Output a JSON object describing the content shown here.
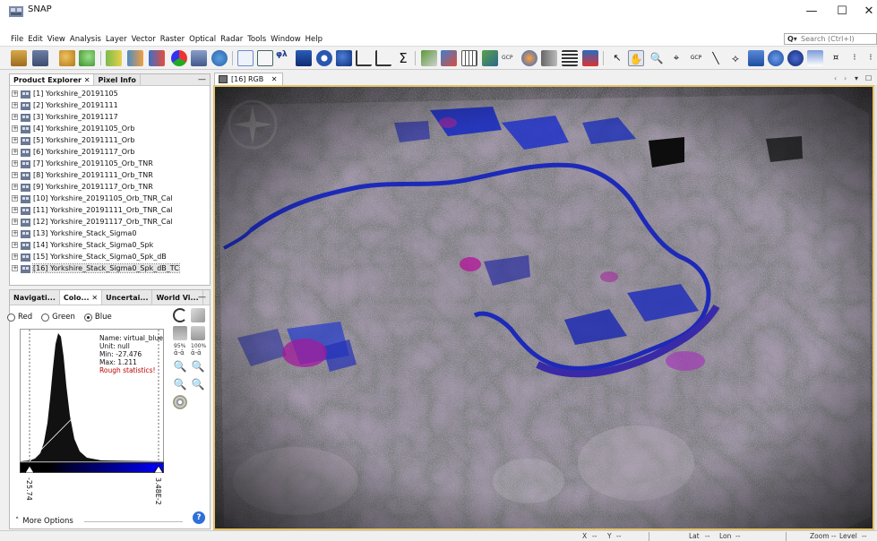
{
  "window": {
    "title": "SNAP",
    "minimize": "—",
    "maximize": "☐",
    "close": "✕"
  },
  "menu": [
    "File",
    "Edit",
    "View",
    "Analysis",
    "Layer",
    "Vector",
    "Raster",
    "Optical",
    "Radar",
    "Tools",
    "Window",
    "Help"
  ],
  "search": {
    "placeholder": "Search (Ctrl+I)"
  },
  "product_panel": {
    "tabs": [
      "Product Explorer",
      "Pixel Info"
    ],
    "close_glyph": "✕",
    "minimize": "—",
    "items": [
      "[1] Yorkshire_20191105",
      "[2] Yorkshire_20191111",
      "[3] Yorkshire_20191117",
      "[4] Yorkshire_20191105_Orb",
      "[5] Yorkshire_20191111_Orb",
      "[6] Yorkshire_20191117_Orb",
      "[7] Yorkshire_20191105_Orb_TNR",
      "[8] Yorkshire_20191111_Orb_TNR",
      "[9] Yorkshire_20191117_Orb_TNR",
      "[10] Yorkshire_20191105_Orb_TNR_Cal",
      "[11] Yorkshire_20191111_Orb_TNR_Cal",
      "[12] Yorkshire_20191117_Orb_TNR_Cal",
      "[13] Yorkshire_Stack_Sigma0",
      "[14] Yorkshire_Stack_Sigma0_Spk",
      "[15] Yorkshire_Stack_Sigma0_Spk_dB",
      "[16] Yorkshire_Stack_Sigma0_Spk_dB_TC"
    ],
    "selected_index": 15
  },
  "tool_panel": {
    "tabs": [
      "Navigati...",
      "Colo...",
      "Uncertai...",
      "World Vi..."
    ],
    "close_glyph": "✕",
    "minimize": "—",
    "channels": [
      "Red",
      "Green",
      "Blue"
    ],
    "selected_channel": "Blue",
    "stats": {
      "name": "Name: virtual_blue",
      "unit": "Unit: null",
      "min": "Min: -27.476",
      "max": "Max: 1.211",
      "warning": "Rough statistics!"
    },
    "slider_min": "-25.74",
    "slider_max": "3.48E-2",
    "percent_95": "95%",
    "percent_100": "100%",
    "more_options": "More Options",
    "more_glyph": "˄",
    "help": "?"
  },
  "view": {
    "tab_label": "[16] RGB",
    "tab_close": "✕",
    "ctrl_left": "‹",
    "ctrl_right": "›",
    "ctrl_menu": "▾",
    "ctrl_max": "☐"
  },
  "status": {
    "x": "X",
    "x_val": "--",
    "y": "Y",
    "y_val": "--",
    "lat": "Lat",
    "lat_val": "--",
    "lon": "Lon",
    "lon_val": "--",
    "zoom": "Zoom",
    "zoom_val": "--",
    "level": "Level",
    "level_val": "--"
  },
  "colors": {
    "accent": "#e3c26a",
    "water": "#1c2fc8",
    "warning": "#bb0000"
  }
}
